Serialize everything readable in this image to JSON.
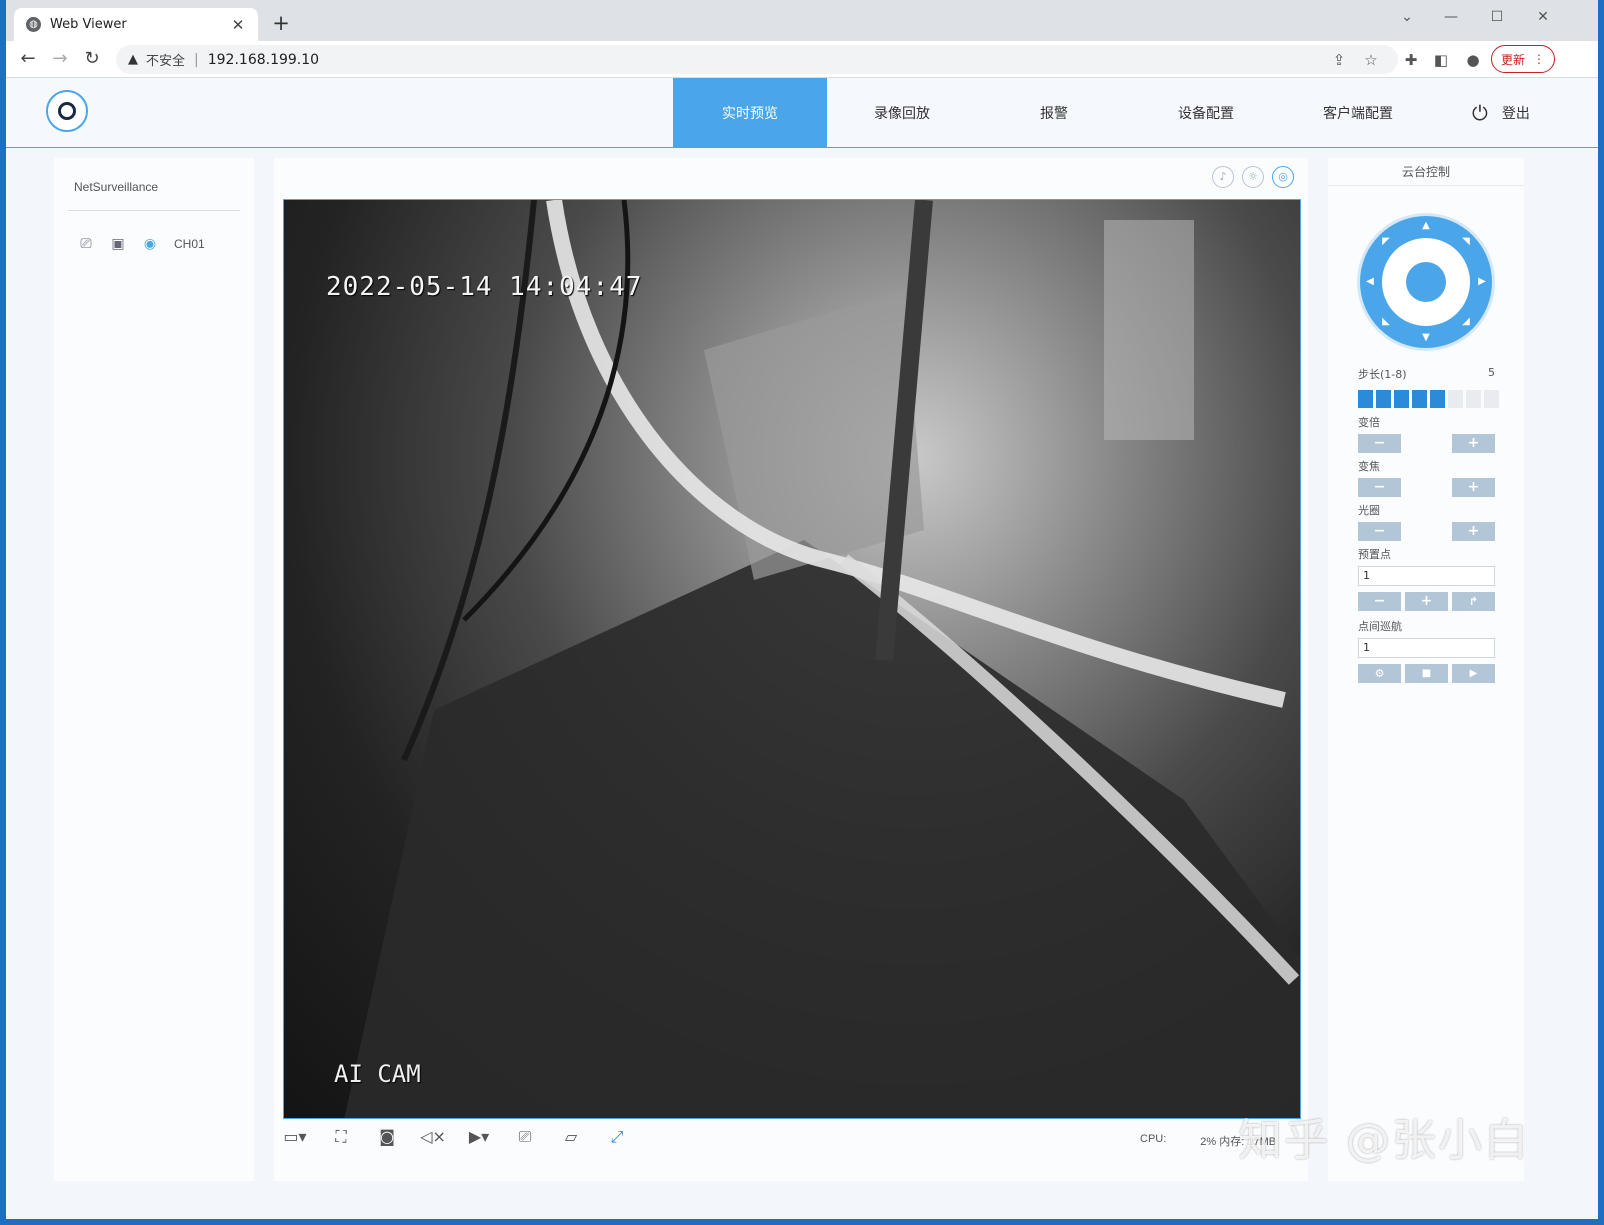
{
  "browser": {
    "tab_title": "Web Viewer",
    "tab_close": "✕",
    "new_tab": "+",
    "security_label": "不安全",
    "separator": "|",
    "url": "192.168.199.10",
    "update_label": "更新"
  },
  "app": {
    "nav": [
      {
        "label": "实时预览"
      },
      {
        "label": "录像回放"
      },
      {
        "label": "报警"
      },
      {
        "label": "设备配置"
      },
      {
        "label": "客户端配置"
      }
    ],
    "logout_label": "登出"
  },
  "left_panel": {
    "device_name": "NetSurveillance",
    "channel_label": "CH01"
  },
  "video": {
    "osd_timestamp": "2022-05-14 14:04:47",
    "osd_camera_name": "AI CAM"
  },
  "status": {
    "cpu_label": "CPU:",
    "cpu_value": "2%",
    "mem_label": "内存:",
    "mem_value": "17MB"
  },
  "ptz": {
    "title": "云台控制",
    "step_label": "步长(1-8)",
    "step_value": "5",
    "step_level": 5,
    "step_max": 8,
    "zoom_label": "变倍",
    "focus_label": "变焦",
    "iris_label": "光圈",
    "preset_label": "预置点",
    "preset_value": "1",
    "tour_label": "点间巡航",
    "tour_value": "1"
  },
  "watermark": "知乎 @张小白"
}
